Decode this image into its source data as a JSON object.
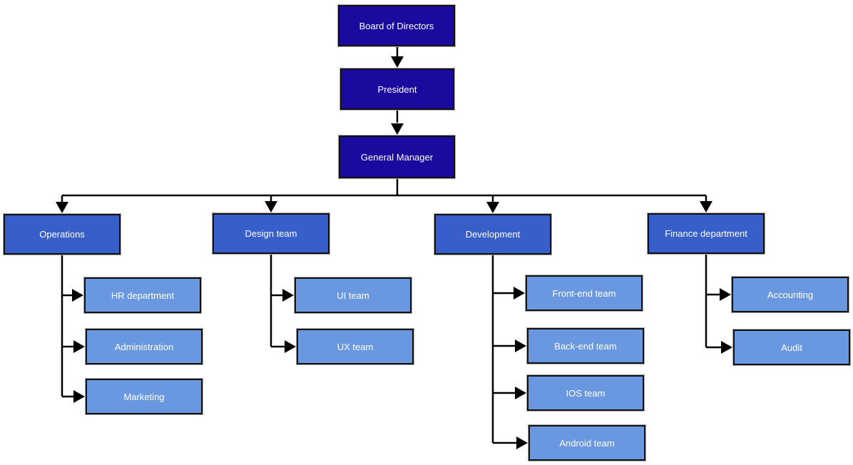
{
  "colors": {
    "top": "#1a0a9e",
    "department": "#385fc9",
    "team": "#6a98e0",
    "connector": "#000000"
  },
  "top": {
    "board": "Board of Directors",
    "president": "President",
    "general_manager": "General Manager"
  },
  "departments": [
    {
      "label": "Operations",
      "teams": [
        "HR department",
        "Administration",
        "Marketing"
      ]
    },
    {
      "label": "Design team",
      "teams": [
        "UI team",
        "UX team"
      ]
    },
    {
      "label": "Development",
      "teams": [
        "Front-end team",
        "Back-end team",
        "IOS team",
        "Android team"
      ]
    },
    {
      "label": "Finance department",
      "teams": [
        "Accounting",
        "Audit"
      ]
    }
  ]
}
